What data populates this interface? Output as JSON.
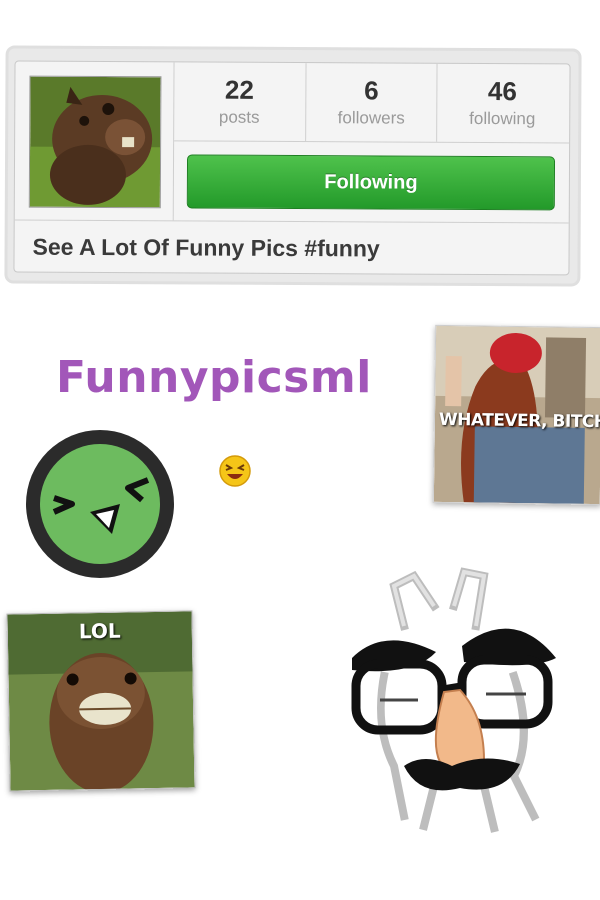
{
  "profile": {
    "stats": [
      {
        "value": "22",
        "label": "posts"
      },
      {
        "value": "6",
        "label": "followers"
      },
      {
        "value": "46",
        "label": "following"
      }
    ],
    "follow_button_label": "Following",
    "bio": "See A Lot Of Funny Pics #funny"
  },
  "title": "Funnypicsml",
  "stickers": {
    "whatever_caption": "WHATEVER, BITCH",
    "lol_caption": "LOL"
  },
  "colors": {
    "title": "#a257b9",
    "button": "#2ea52f",
    "face_green": "#6dbb5f"
  },
  "icons": [
    "laughing-face-emoji",
    "green-laughing-face-icon",
    "groucho-disguise-icon"
  ]
}
